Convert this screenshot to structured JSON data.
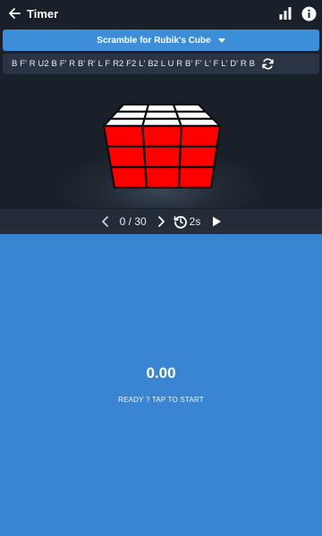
{
  "appbar": {
    "title": "Timer",
    "back_icon": "arrow-left-icon",
    "stats_icon": "bar-chart-icon",
    "info_icon": "info-icon"
  },
  "scramble_select": {
    "label": "Scramble for Rubik's Cube",
    "caret_icon": "caret-down-icon"
  },
  "scramble": {
    "text": "B F' R U2 B F' R B' R' L F R2 F2 L' B2 L U R B' F' L' F L' D' R B",
    "refresh_icon": "refresh-icon"
  },
  "cube": {
    "top_color": "#ffffff",
    "front_color": "#ff0000",
    "edge_color": "#0b0d10"
  },
  "playback": {
    "prev_icon": "chevron-left-icon",
    "counter": "0 / 30",
    "next_icon": "chevron-right-icon",
    "speed": "2s",
    "speed_icon": "timer-reset-icon",
    "play_icon": "play-icon"
  },
  "timer": {
    "value": "0.00",
    "hint": "READY ? TAP TO START",
    "background": "#3a85d1"
  }
}
